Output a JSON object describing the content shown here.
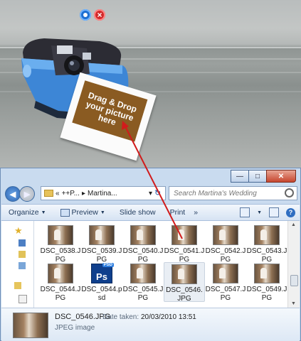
{
  "widget": {
    "photo_text": "Drag & Drop your picture here",
    "settings_icon": "settings-icon",
    "close_icon": "close-icon"
  },
  "window": {
    "caption_buttons": {
      "minimize": "—",
      "maximize": "□",
      "close": "✕"
    },
    "address": {
      "prefix": "«",
      "crumb1": "++P...",
      "sep": "▸",
      "crumb2": "Martina...",
      "dropdown": "▾",
      "refresh": "↻"
    },
    "search": {
      "placeholder": "Search Martina's Wedding"
    },
    "toolbar": {
      "organize": "Organize",
      "preview": "Preview",
      "slideshow": "Slide show",
      "print": "Print",
      "more": "»"
    },
    "files": [
      {
        "name": "DSC_0538.JPG",
        "type": "jpg"
      },
      {
        "name": "DSC_0539.JPG",
        "type": "jpg"
      },
      {
        "name": "DSC_0540.JPG",
        "type": "jpg"
      },
      {
        "name": "DSC_0541.JPG",
        "type": "jpg"
      },
      {
        "name": "DSC_0542.JPG",
        "type": "jpg"
      },
      {
        "name": "DSC_0543.JPG",
        "type": "jpg"
      },
      {
        "name": "DSC_0544.JPG",
        "type": "jpg"
      },
      {
        "name": "DSC_0544.psd",
        "type": "psd"
      },
      {
        "name": "DSC_0545.JPG",
        "type": "jpg"
      },
      {
        "name": "DSC_0546.JPG",
        "type": "jpg",
        "selected": true
      },
      {
        "name": "DSC_0547.JPG",
        "type": "jpg"
      },
      {
        "name": "DSC_0549.JPG",
        "type": "jpg"
      }
    ],
    "psd_badge": "PSD",
    "psd_glyph": "Ps",
    "details": {
      "name": "DSC_0546.JPG",
      "date_label": "Date taken:",
      "date_value": "20/03/2010 13:51",
      "type": "JPEG image"
    }
  },
  "colors": {
    "arrow": "#d11b1b",
    "camera_blue": "#3d86d6",
    "photo_brown": "#8a5b22"
  }
}
